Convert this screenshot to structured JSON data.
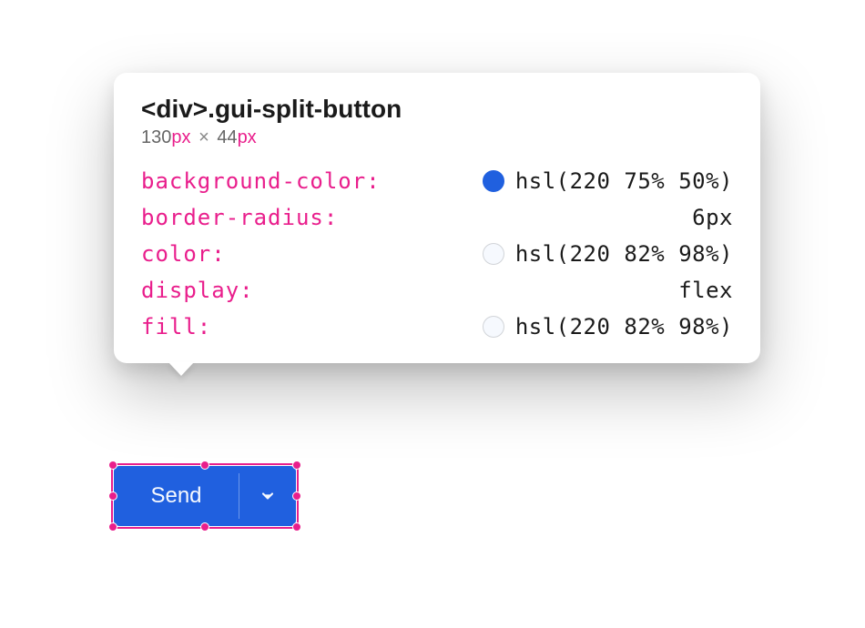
{
  "tooltip": {
    "selector": "<div>.gui-split-button",
    "dimensions": {
      "width": "130",
      "width_unit": "px",
      "separator": "×",
      "height": "44",
      "height_unit": "px"
    },
    "properties": [
      {
        "name": "background-color",
        "value": "hsl(220 75% 50%)",
        "swatch": "blue"
      },
      {
        "name": "border-radius",
        "value": "6px",
        "swatch": null
      },
      {
        "name": "color",
        "value": "hsl(220 82% 98%)",
        "swatch": "light"
      },
      {
        "name": "display",
        "value": "flex",
        "swatch": null
      },
      {
        "name": "fill",
        "value": "hsl(220 82% 98%)",
        "swatch": "light"
      }
    ]
  },
  "button": {
    "label": "Send"
  },
  "colors": {
    "accent": "#2059df",
    "selection": "#e91e8c"
  }
}
